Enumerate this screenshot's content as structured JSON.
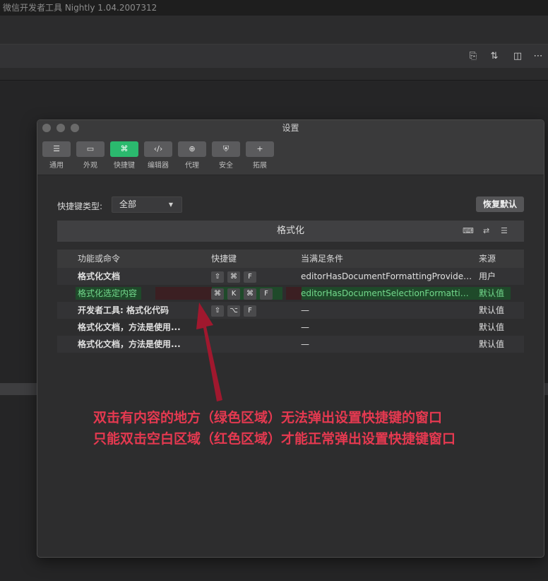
{
  "app": {
    "title": "微信开发者工具 Nightly 1.04.2007312"
  },
  "toolbar": {
    "icons": [
      "new-file-icon",
      "source-control-icon",
      "split-editor-icon",
      "more-icon"
    ]
  },
  "dialog": {
    "title": "设置",
    "tabs": [
      {
        "label": "通用",
        "icon": "general-icon",
        "glyph": "☰"
      },
      {
        "label": "外观",
        "icon": "appearance-icon",
        "glyph": "▭"
      },
      {
        "label": "快捷键",
        "icon": "shortcut-icon",
        "glyph": "⌘",
        "active": true
      },
      {
        "label": "编辑器",
        "icon": "editor-icon",
        "glyph": "‹/›"
      },
      {
        "label": "代理",
        "icon": "proxy-icon",
        "glyph": "⊕"
      },
      {
        "label": "安全",
        "icon": "security-icon",
        "glyph": "⛨"
      },
      {
        "label": "拓展",
        "icon": "extension-icon",
        "glyph": "+"
      }
    ],
    "shortcut_type_label": "快捷键类型:",
    "shortcut_type_value": "全部",
    "restore_button": "恢复默认",
    "search_value": "格式化",
    "table": {
      "headers": {
        "command": "功能或命令",
        "keys": "快捷键",
        "when": "当满足条件",
        "source": "来源"
      },
      "rows": [
        {
          "command": "格式化文档",
          "keys": [
            "⇧",
            "⌘",
            "F"
          ],
          "when": "editorHasDocumentFormattingProvide…",
          "source": "用户"
        },
        {
          "command": "格式化选定内容",
          "keys": [
            "⌘",
            "K",
            "⌘",
            "F"
          ],
          "when": "editorHasDocumentSelectionFormatti…",
          "source": "默认值"
        },
        {
          "command": "开发者工具: 格式化代码",
          "keys": [
            "⇧",
            "⌥",
            "F"
          ],
          "when": "—",
          "source": "默认值"
        },
        {
          "command": "格式化文档，方法是使用...",
          "keys": [],
          "when": "—",
          "source": "默认值"
        },
        {
          "command": "格式化文档，方法是使用...",
          "keys": [],
          "when": "—",
          "source": "默认值"
        }
      ]
    }
  },
  "annotation": {
    "line1": "双击有内容的地方（绿色区域）无法弹出设置快捷键的窗口",
    "line2": "只能双击空白区域（红色区域）才能正常弹出设置快捷键窗口"
  },
  "colors": {
    "accent": "#2bb96e",
    "annotation": "#e53950",
    "arrow": "#a0182e"
  }
}
